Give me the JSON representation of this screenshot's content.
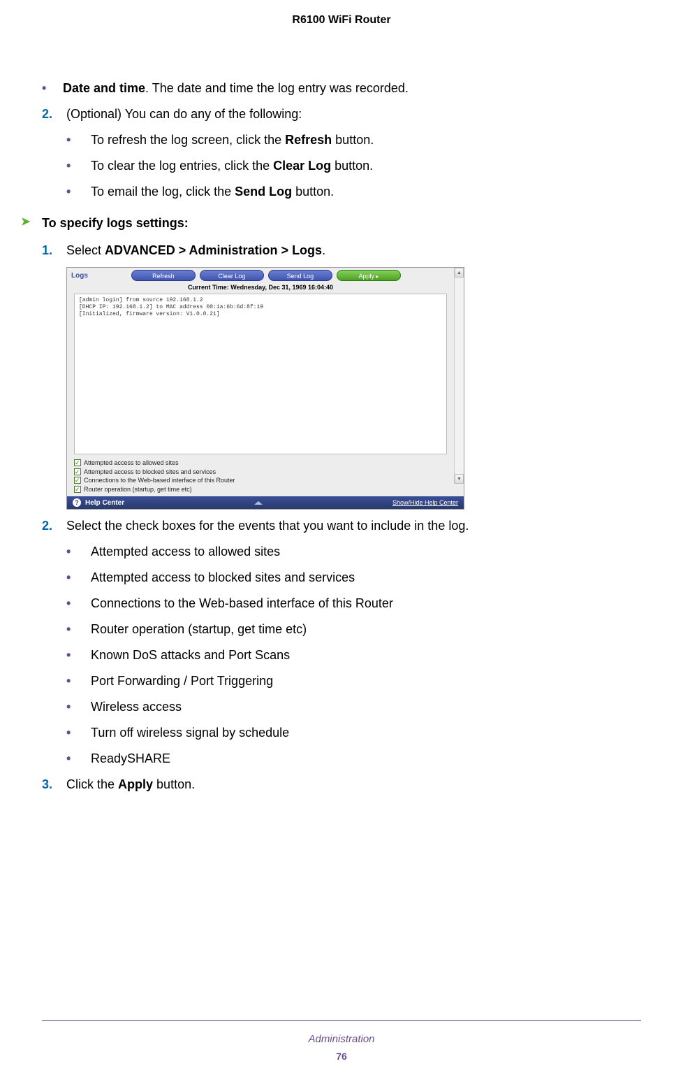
{
  "header": {
    "title": "R6100 WiFi Router"
  },
  "content": {
    "bullet_date": {
      "term": "Date and time",
      "desc": ". The date and time the log entry was recorded."
    },
    "step2a": {
      "num": "2.",
      "text_before": "(Optional) You can do any of the following:",
      "subs": [
        {
          "before": "To refresh the log screen, click the ",
          "strong": "Refresh",
          "after": " button."
        },
        {
          "before": "To clear the log entries, click the ",
          "strong": "Clear Log",
          "after": " button."
        },
        {
          "before": "To email the log, click the ",
          "strong": "Send Log",
          "after": " button."
        }
      ]
    },
    "section": {
      "heading": "To specify logs settings:"
    },
    "step1": {
      "num": "1.",
      "before": "Select ",
      "strong": "ADVANCED > Administration > Logs",
      "after": "."
    },
    "step2b": {
      "num": "2.",
      "text": "Select the check boxes for the events that you want to include in the log.",
      "subs": [
        "Attempted access to allowed sites",
        "Attempted access to blocked sites and services",
        "Connections to the Web-based interface of this Router",
        "Router operation (startup, get time etc)",
        "Known DoS attacks and Port Scans",
        "Port Forwarding / Port Triggering",
        "Wireless access",
        "Turn off wireless signal by schedule",
        "ReadySHARE"
      ]
    },
    "step3": {
      "num": "3.",
      "before": "Click the ",
      "strong": "Apply",
      "after": " button."
    }
  },
  "screenshot": {
    "title": "Logs",
    "buttons": {
      "refresh": "Refresh",
      "clearlog": "Clear Log",
      "sendlog": "Send Log",
      "apply": "Apply"
    },
    "time": "Current Time: Wednesday, Dec 31, 1969 16:04:40",
    "log_lines": [
      "[admin login] from source 192.168.1.2",
      "[DHCP IP: 192.168.1.2] to MAC address 00:1a:6b:6d:8f:19",
      "[Initialized, firmware version: V1.0.0.21]"
    ],
    "checks": [
      "Attempted access to allowed sites",
      "Attempted access to blocked sites and services",
      "Connections to the Web-based interface of this Router",
      "Router operation (startup, get time etc)"
    ],
    "helpcenter": "Help Center",
    "helplink": "Show/Hide Help Center"
  },
  "footer": {
    "section": "Administration",
    "page": "76"
  }
}
